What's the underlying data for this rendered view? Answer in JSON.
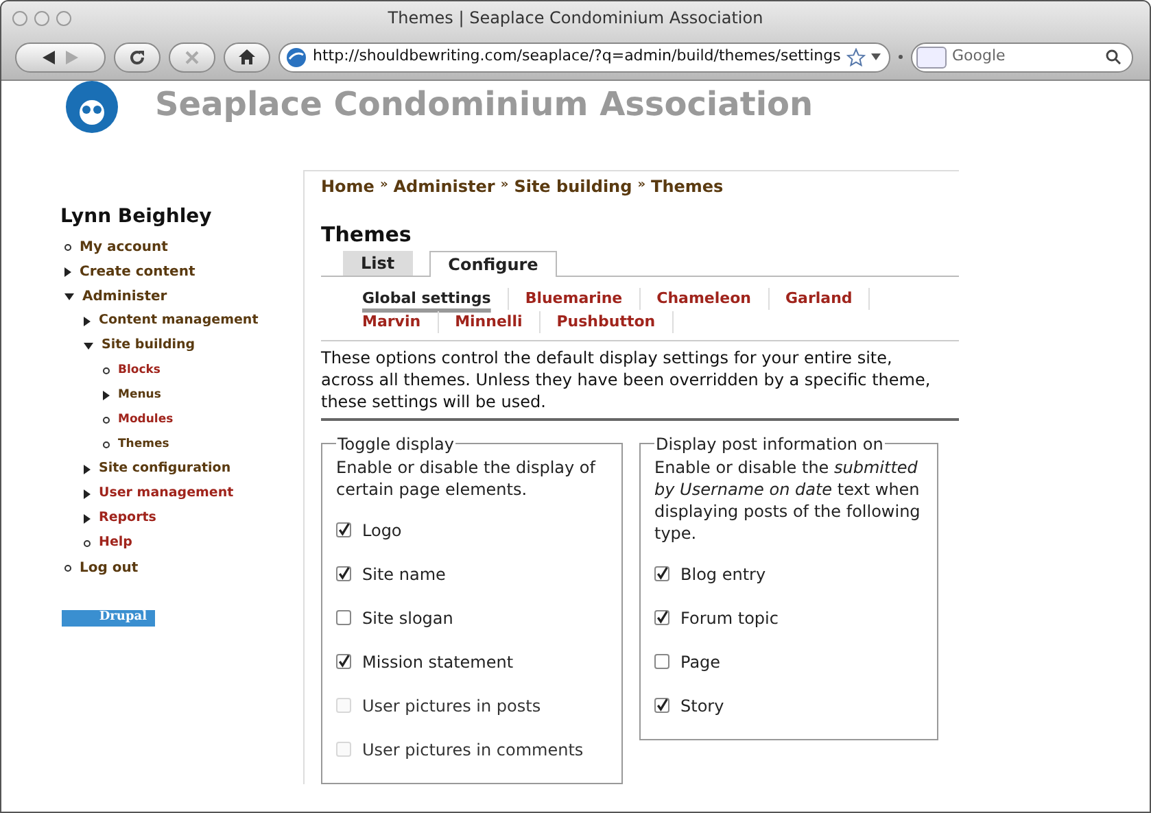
{
  "window": {
    "title": "Themes | Seaplace Condominium Association"
  },
  "toolbar": {
    "url": "http://shouldbewriting.com/seaplace/?q=admin/build/themes/settings",
    "search": {
      "placeholder": "Google"
    }
  },
  "site": {
    "name": "Seaplace Condominium Association"
  },
  "sidebar": {
    "user": "Lynn Beighley",
    "items": [
      {
        "label": "My account",
        "kind": "leaf",
        "visited": true
      },
      {
        "label": "Create content",
        "kind": "collapsed",
        "visited": true
      },
      {
        "label": "Administer",
        "kind": "expanded",
        "visited": true,
        "children": [
          {
            "label": "Content management",
            "kind": "collapsed",
            "visited": true
          },
          {
            "label": "Site building",
            "kind": "expanded",
            "visited": true,
            "children": [
              {
                "label": "Blocks",
                "kind": "leaf",
                "visited": false
              },
              {
                "label": "Menus",
                "kind": "collapsed",
                "visited": true
              },
              {
                "label": "Modules",
                "kind": "leaf",
                "visited": false
              },
              {
                "label": "Themes",
                "kind": "leaf",
                "visited": true
              }
            ]
          },
          {
            "label": "Site configuration",
            "kind": "collapsed",
            "visited": true
          },
          {
            "label": "User management",
            "kind": "collapsed",
            "visited": false
          },
          {
            "label": "Reports",
            "kind": "collapsed",
            "visited": false
          },
          {
            "label": "Help",
            "kind": "leaf",
            "visited": false
          }
        ]
      },
      {
        "label": "Log out",
        "kind": "leaf",
        "visited": true
      }
    ],
    "badge": "Drupal"
  },
  "breadcrumb": [
    "Home",
    "Administer",
    "Site building",
    "Themes"
  ],
  "breadcrumb_separator": "»",
  "title": "Themes",
  "tabs": [
    {
      "label": "List",
      "selected": false
    },
    {
      "label": "Configure",
      "selected": true
    }
  ],
  "subtabs": [
    [
      {
        "label": "Global settings",
        "selected": true
      },
      {
        "label": "Bluemarine",
        "selected": false
      },
      {
        "label": "Chameleon",
        "selected": false
      },
      {
        "label": "Garland",
        "selected": false
      }
    ],
    [
      {
        "label": "Marvin",
        "selected": false
      },
      {
        "label": "Minnelli",
        "selected": false
      },
      {
        "label": "Pushbutton",
        "selected": false
      }
    ]
  ],
  "intro": "These options control the default display settings for your entire site, across all themes. Unless they have been overridden by a specific theme, these settings will be used.",
  "fieldsets": [
    {
      "legend": "Toggle display",
      "description": "Enable or disable the display of certain page elements.",
      "options": [
        {
          "label": "Logo",
          "checked": true,
          "disabled": false
        },
        {
          "label": "Site name",
          "checked": true,
          "disabled": false
        },
        {
          "label": "Site slogan",
          "checked": false,
          "disabled": false
        },
        {
          "label": "Mission statement",
          "checked": true,
          "disabled": false
        },
        {
          "label": "User pictures in posts",
          "checked": false,
          "disabled": true
        },
        {
          "label": "User pictures in comments",
          "checked": false,
          "disabled": true
        }
      ]
    },
    {
      "legend": "Display post information on",
      "description": "Enable or disable the *submitted by Username on date* text when displaying posts of the following type.",
      "options": [
        {
          "label": "Blog entry",
          "checked": true,
          "disabled": false
        },
        {
          "label": "Forum topic",
          "checked": true,
          "disabled": false
        },
        {
          "label": "Page",
          "checked": false,
          "disabled": false
        },
        {
          "label": "Story",
          "checked": true,
          "disabled": false
        }
      ]
    }
  ]
}
